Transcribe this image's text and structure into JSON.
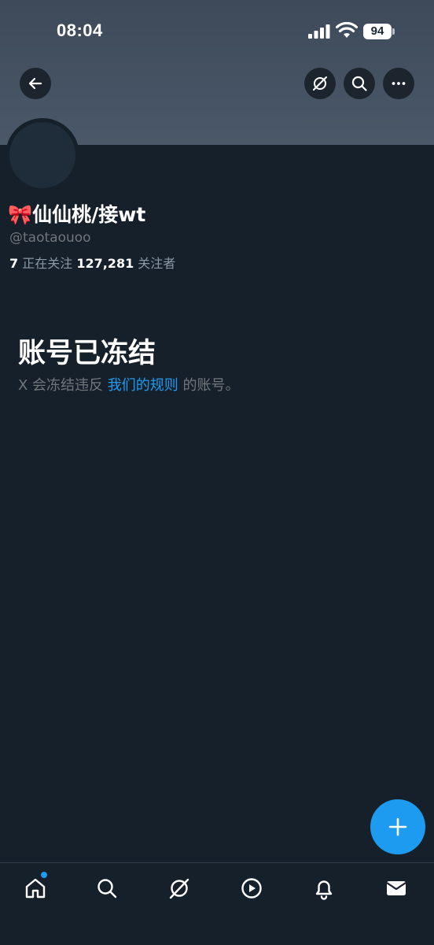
{
  "status_bar": {
    "time": "08:04",
    "battery": "94"
  },
  "header": {
    "back_icon": "arrow-left-icon",
    "grok_icon": "grok-icon",
    "search_icon": "search-icon",
    "more_icon": "more-horizontal-icon"
  },
  "profile": {
    "display_name": "🎀仙仙桃/接wt",
    "handle": "@taotaouoo",
    "following_count": "7",
    "following_label": " 正在关注 ",
    "followers_count": "127,281",
    "followers_label": " 关注者"
  },
  "frozen_notice": {
    "title": "账号已冻结",
    "desc_prefix": "X 会冻结违反 ",
    "rules_link": "我们的规则",
    "desc_suffix": " 的账号。"
  },
  "fab": {
    "icon": "plus-icon"
  },
  "tab_bar": {
    "items": [
      "home-icon",
      "search-icon",
      "grok-icon",
      "video-icon",
      "notifications-icon",
      "messages-icon"
    ],
    "home_has_badge": true
  },
  "colors": {
    "background": "#16202a",
    "banner": "#46536a",
    "accent": "#1d9bf0",
    "muted_text": "#71767b"
  }
}
